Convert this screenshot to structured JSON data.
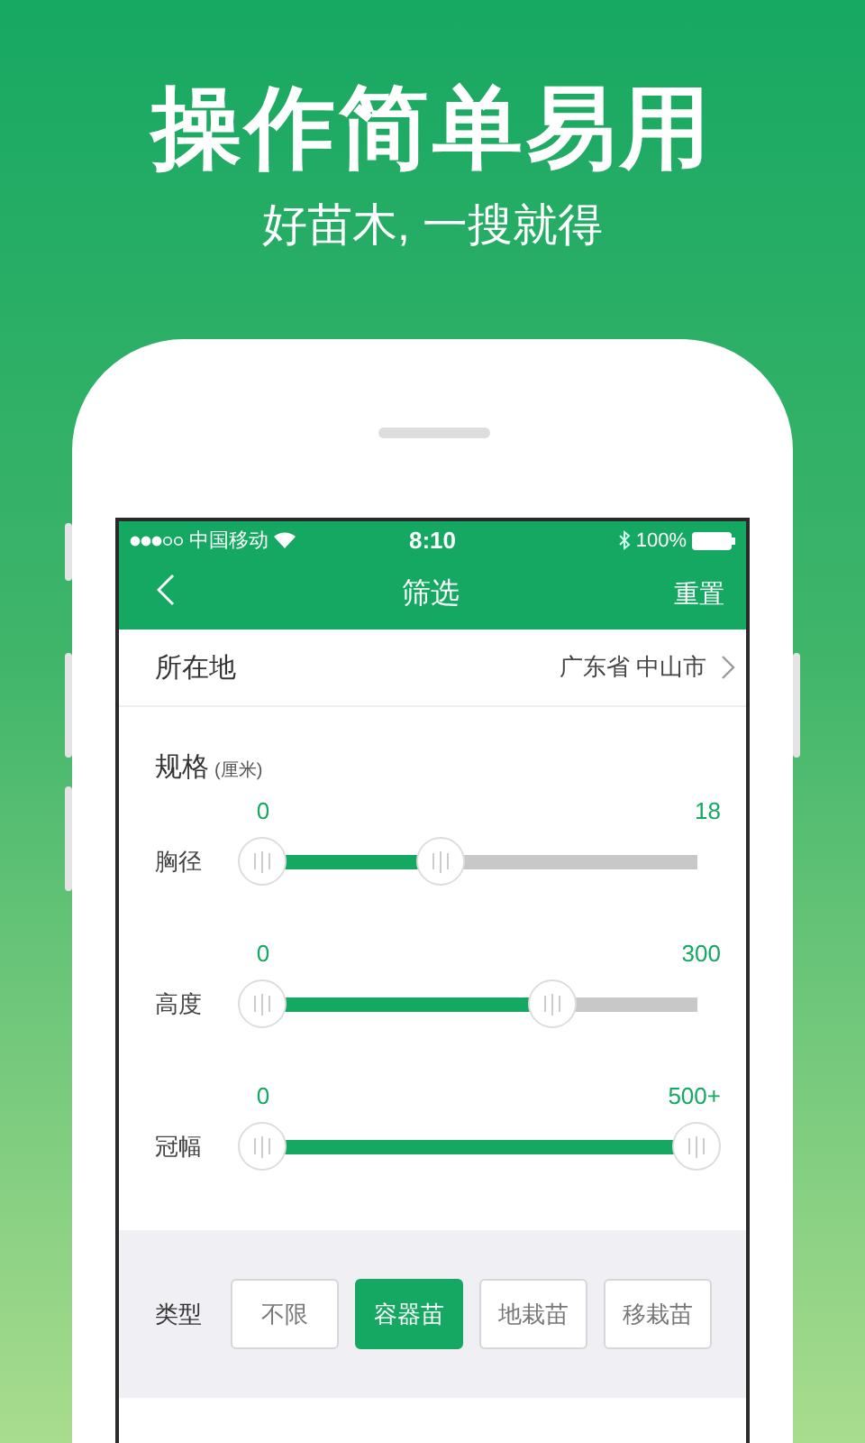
{
  "promo": {
    "title": "操作简单易用",
    "subtitle": "好苗木, 一搜就得"
  },
  "status_bar": {
    "carrier": "中国移动",
    "time": "8:10",
    "battery": "100%"
  },
  "nav": {
    "title": "筛选",
    "action": "重置"
  },
  "location": {
    "label": "所在地",
    "value": "广东省 中山市"
  },
  "spec": {
    "title": "规格",
    "unit": "(厘米)",
    "sliders": [
      {
        "name": "胸径",
        "min": "0",
        "max": "18",
        "level": 0.41
      },
      {
        "name": "高度",
        "min": "0",
        "max": "300",
        "level": 0.67
      },
      {
        "name": "冠幅",
        "min": "0",
        "max": "500+",
        "level": 1
      }
    ]
  },
  "type": {
    "label": "类型",
    "options": [
      {
        "label": "不限",
        "selected": false
      },
      {
        "label": "容器苗",
        "selected": true
      },
      {
        "label": "地栽苗",
        "selected": false
      },
      {
        "label": "移栽苗",
        "selected": false
      }
    ]
  }
}
